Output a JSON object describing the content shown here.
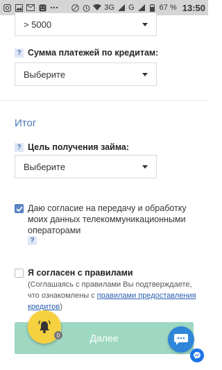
{
  "status_bar": {
    "battery": "67 %",
    "time": "13:50",
    "network": "3G",
    "network2": "G"
  },
  "form": {
    "income_select": {
      "value": ">  5000"
    },
    "credit_payments": {
      "help": "?",
      "label": "Сумма платежей по кредитам:",
      "select_value": "Выберите"
    },
    "summary_title": "Итог",
    "loan_purpose": {
      "help": "?",
      "label": "Цель получения займа:",
      "select_value": "Выберите"
    },
    "telecom_consent": {
      "text": "Даю согласие на передачу и обработку моих данных телекоммуникационными операторами",
      "help": "?",
      "checked": true
    },
    "rules": {
      "title": "Я согласен с правилами",
      "note_prefix": "(Соглашаясь с правилами Вы подтверждаете, что ознакомлены с ",
      "link": "правилами предоставления кредитов",
      "note_suffix": ")",
      "checked": false
    },
    "submit_label": "Далее"
  },
  "widgets": {
    "bell_badge": "0"
  },
  "colors": {
    "accent": "#4a76b8",
    "submit": "#9fd8c2",
    "bell": "#f6d13f",
    "chat": "#2f86d9"
  }
}
